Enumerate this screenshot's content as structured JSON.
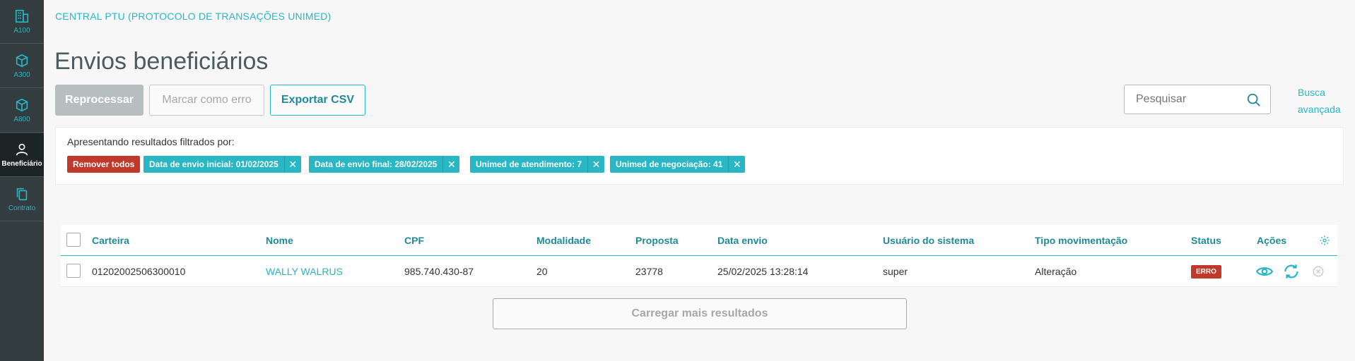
{
  "sidebar": {
    "items": [
      {
        "label": "A100",
        "icon": "building-icon"
      },
      {
        "label": "A300",
        "icon": "box-icon"
      },
      {
        "label": "A800",
        "icon": "box-icon"
      },
      {
        "label": "Beneficiário",
        "icon": "person-icon",
        "active": true
      },
      {
        "label": "Contrato",
        "icon": "copy-icon"
      }
    ]
  },
  "header": {
    "breadcrumb": "CENTRAL PTU (PROTOCOLO DE TRANSAÇÕES UNIMED)",
    "title": "Envios beneficiários"
  },
  "toolbar": {
    "reprocess_label": "Reprocessar",
    "mark_error_label": "Marcar como erro",
    "export_label": "Exportar CSV"
  },
  "search": {
    "placeholder": "Pesquisar",
    "advanced_label_line1": "Busca",
    "advanced_label_line2": "avançada"
  },
  "filters": {
    "label": "Apresentando resultados filtrados por:",
    "remove_all": "Remover todos",
    "chips": [
      "Data de envio inicial: 01/02/2025",
      "Data de envio final: 28/02/2025",
      "Unimed de atendimento: 7",
      "Unimed de negociação: 41"
    ]
  },
  "table": {
    "columns": [
      "Carteira",
      "Nome",
      "CPF",
      "Modalidade",
      "Proposta",
      "Data envio",
      "Usuário do sistema",
      "Tipo movimentação",
      "Status",
      "Ações"
    ],
    "rows": [
      {
        "carteira": "01202002506300010",
        "nome": "WALLY WALRUS",
        "cpf": "985.740.430-87",
        "modalidade": "20",
        "proposta": "23778",
        "data_envio": "25/02/2025 13:28:14",
        "usuario": "super",
        "tipo": "Alteração",
        "status": "ERRO"
      }
    ]
  },
  "load_more_label": "Carregar mais resultados",
  "colors": {
    "accent": "#29b6c5",
    "sidebar_bg": "#333d40",
    "error": "#c0392b"
  }
}
